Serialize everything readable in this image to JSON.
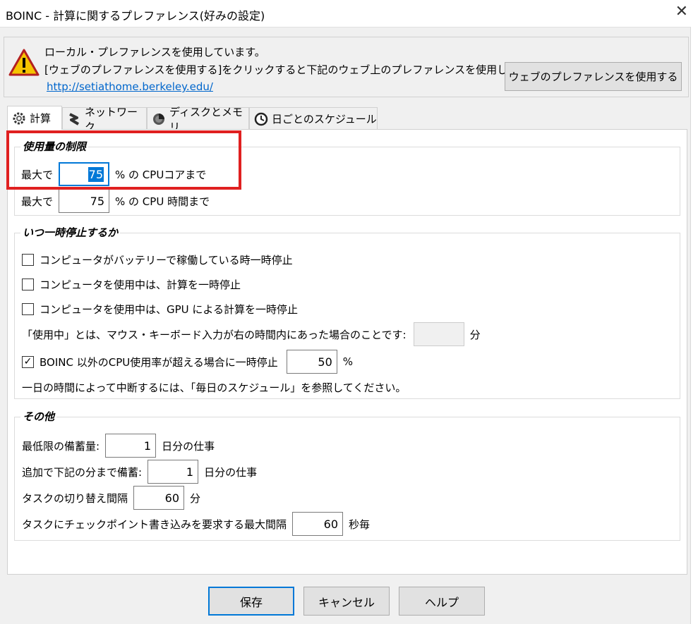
{
  "window": {
    "title": "BOINC - 計算に関するプレファレンス(好みの設定)",
    "close_glyph": "✕"
  },
  "info": {
    "line1": "ローカル・プレファレンスを使用しています。",
    "line2": "[ウェブのプレファレンスを使用する]をクリックすると下記のウェブ上のプレファレンスを使用します:",
    "link": "http://setiathome.berkeley.edu/",
    "use_web_button": "ウェブのプレファレンスを使用する"
  },
  "tabs": [
    {
      "label": "計算",
      "icon": "gear-icon",
      "active": true
    },
    {
      "label": "ネットワーク",
      "icon": "network-icon",
      "active": false
    },
    {
      "label": "ディスクとメモリ",
      "icon": "disk-icon",
      "active": false
    },
    {
      "label": "日ごとのスケジュール",
      "icon": "clock-icon",
      "active": false
    }
  ],
  "usage_limits": {
    "title": "使用量の制限",
    "cpu_cores": {
      "prefix": "最大で",
      "value": "75",
      "suffix": "% の CPUコアまで"
    },
    "cpu_time": {
      "prefix": "最大で",
      "value": "75",
      "suffix": "% の CPU 時間まで"
    }
  },
  "suspend": {
    "title": "いつ一時停止するか",
    "on_battery": {
      "label": "コンピュータがバッテリーで稼働している時一時停止",
      "checked": false
    },
    "in_use": {
      "label": "コンピュータを使用中は、計算を一時停止",
      "checked": false
    },
    "gpu_in_use": {
      "label": "コンピュータを使用中は、GPU による計算を一時停止",
      "checked": false
    },
    "in_use_definition": {
      "label": "「使用中」とは、マウス・キーボード入力が右の時間内にあった場合のことです:",
      "value": "",
      "suffix": "分"
    },
    "non_boinc_cpu": {
      "label": "BOINC 以外のCPU使用率が超える場合に一時停止",
      "checked": true,
      "value": "50",
      "suffix": "%"
    },
    "schedule_note": "一日の時間によって中断するには、「毎日のスケジュール」を参照してください。"
  },
  "other": {
    "title": "その他",
    "min_buffer": {
      "label": "最低限の備蓄量:",
      "value": "1",
      "suffix": "日分の仕事"
    },
    "extra_buffer": {
      "label": "追加で下記の分まで備蓄:",
      "value": "1",
      "suffix": "日分の仕事"
    },
    "switch_interval": {
      "label": "タスクの切り替え間隔",
      "value": "60",
      "suffix": "分"
    },
    "checkpoint_interval": {
      "label": "タスクにチェックポイント書き込みを要求する最大間隔",
      "value": "60",
      "suffix": "秒毎"
    }
  },
  "buttons": {
    "save": "保存",
    "cancel": "キャンセル",
    "help": "ヘルプ"
  },
  "colors": {
    "accent": "#0078d7",
    "highlight_box": "#e02020",
    "link": "#0066cc",
    "warning": "#f5c400"
  }
}
